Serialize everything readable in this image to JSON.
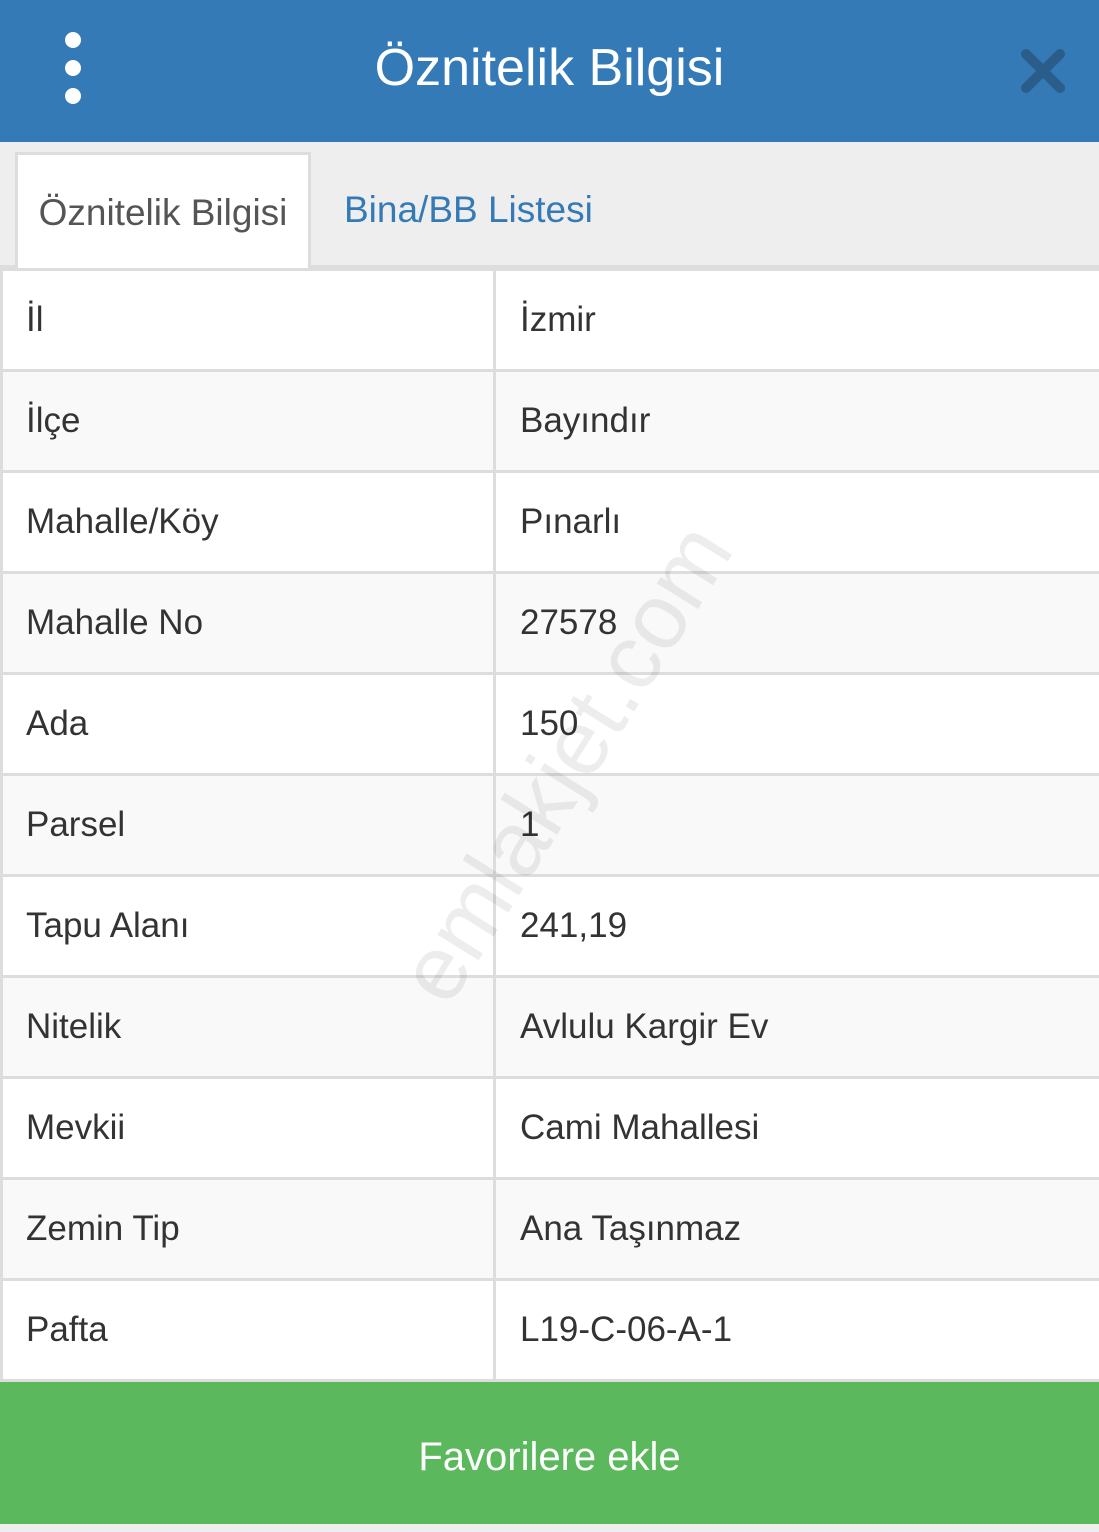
{
  "header": {
    "title": "Öznitelik Bilgisi",
    "menu_icon": "more-vertical-icon",
    "close_icon": "close-icon"
  },
  "tabs": [
    {
      "label": "Öznitelik Bilgisi",
      "active": true
    },
    {
      "label": "Bina/BB Listesi",
      "active": false
    }
  ],
  "rows": [
    {
      "label": "İl",
      "value": "İzmir"
    },
    {
      "label": "İlçe",
      "value": "Bayındır"
    },
    {
      "label": "Mahalle/Köy",
      "value": "Pınarlı"
    },
    {
      "label": "Mahalle No",
      "value": "27578"
    },
    {
      "label": "Ada",
      "value": "150"
    },
    {
      "label": "Parsel",
      "value": "1"
    },
    {
      "label": "Tapu Alanı",
      "value": "241,19"
    },
    {
      "label": "Nitelik",
      "value": "Avlulu Kargir Ev"
    },
    {
      "label": "Mevkii",
      "value": "Cami Mahallesi"
    },
    {
      "label": "Zemin Tip",
      "value": "Ana Taşınmaz"
    },
    {
      "label": "Pafta",
      "value": "L19-C-06-A-1"
    }
  ],
  "watermark": "emlakjet.com",
  "favorite_button": "Favorilere ekle",
  "colors": {
    "header_bg": "#337ab7",
    "tab_link": "#337ab7",
    "button_bg": "#5cb85c"
  }
}
